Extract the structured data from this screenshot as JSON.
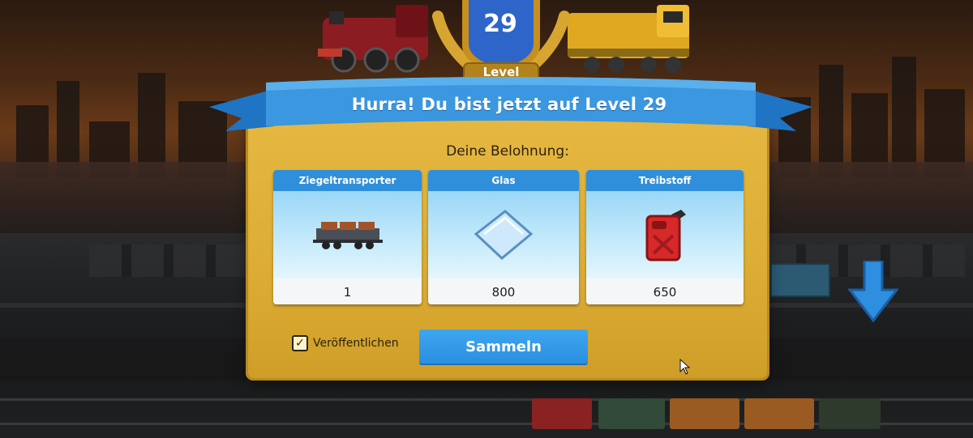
{
  "level": {
    "number": "29",
    "badge_label": "Level"
  },
  "dialog": {
    "title": "Hurra! Du bist jetzt auf Level 29",
    "reward_heading": "Deine Belohnung:",
    "rewards": [
      {
        "name": "Ziegeltransporter",
        "amount": "1",
        "icon": "brick-wagon-icon"
      },
      {
        "name": "Glas",
        "amount": "800",
        "icon": "glass-pane-icon"
      },
      {
        "name": "Treibstoff",
        "amount": "650",
        "icon": "fuel-canister-icon"
      }
    ],
    "publish_label": "Veröffentlichen",
    "publish_checked": true,
    "collect_label": "Sammeln"
  },
  "colors": {
    "panel": "#e0b13a",
    "ribbon": "#2f8fdb",
    "button": "#2a8fe0",
    "card_header": "#2f8fdb"
  }
}
